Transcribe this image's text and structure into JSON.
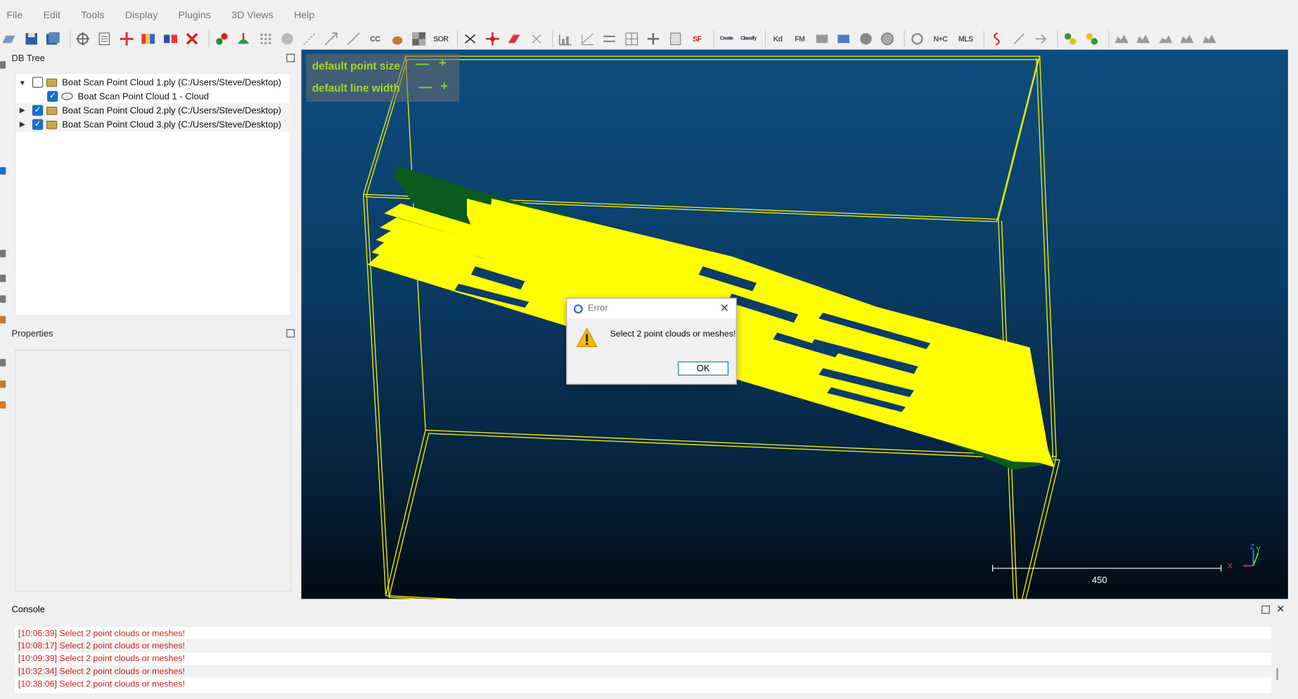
{
  "menu": [
    "File",
    "Edit",
    "Tools",
    "Display",
    "Plugins",
    "3D Views",
    "Help"
  ],
  "toolbar": {
    "icons": [
      "open-icon",
      "save-icon",
      "save-all-icon",
      "pick-icon",
      "list-icon",
      "crosshair-icon",
      "rainbow-icon",
      "transfer-icon",
      "delete-icon"
    ],
    "text_sor": "SOR",
    "text_sf": "SF",
    "text_cc": "CC",
    "text_kd": "Kd",
    "text_fm": "FM",
    "text_nc": "N+C",
    "text_mls": "MLS",
    "text_canupo_create": "Create",
    "text_canupo_classify": "Classify"
  },
  "dbtree": {
    "title": "DB Tree",
    "items": [
      {
        "label": "Boat Scan Point Cloud 1.ply (C:/Users/Steve/Desktop)",
        "checked": false
      },
      {
        "label": "Boat Scan Point Cloud 1 - Cloud",
        "checked": true
      },
      {
        "label": "Boat Scan Point Cloud 2.ply (C:/Users/Steve/Desktop)",
        "checked": true
      },
      {
        "label": "Boat Scan Point Cloud 3.ply (C:/Users/Steve/Desktop)",
        "checked": true
      }
    ]
  },
  "properties": {
    "title": "Properties"
  },
  "viewport": {
    "overlay": {
      "point_size": "default point size",
      "line_width": "default line width",
      "minus": "—",
      "plus": "+"
    },
    "scale_bar_value": "450",
    "axes": {
      "x": "X",
      "y": "Y",
      "z": "Z"
    },
    "colors": {
      "cloud": "#ffff00",
      "dark_cloud": "#0b5a1e",
      "bbox": "#e6e600"
    }
  },
  "console": {
    "title": "Console",
    "logs": [
      "[10:06:39] Select 2 point clouds or meshes!",
      "[10:08:17] Select 2 point clouds or meshes!",
      "[10:09:39] Select 2 point clouds or meshes!",
      "[10:32:34] Select 2 point clouds or meshes!",
      "[10:38:06] Select 2 point clouds or meshes!"
    ]
  },
  "dialog": {
    "title": "Error",
    "message": "Select 2 point clouds or meshes!",
    "ok_label": "OK"
  }
}
